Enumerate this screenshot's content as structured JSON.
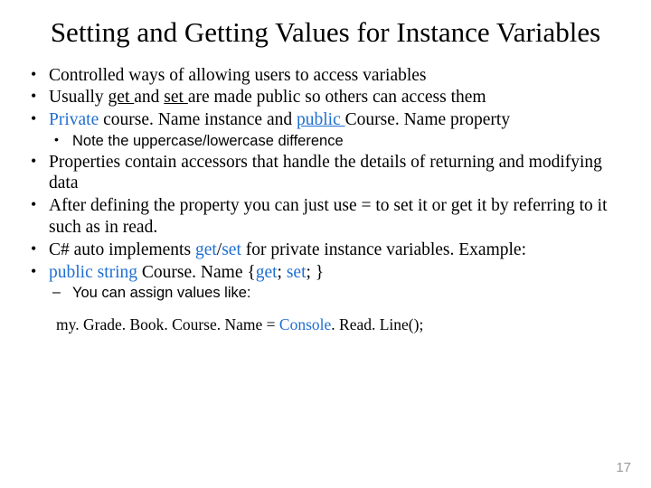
{
  "title": "Setting and Getting Values for Instance Variables",
  "b1": "Controlled ways of allowing users to access variables",
  "b2a": "Usually ",
  "b2b": "get ",
  "b2c": "and ",
  "b2d": "set ",
  "b2e": "are made public so others can access them",
  "b3a": "Private ",
  "b3b": "course. Name instance and ",
  "b3c": "public ",
  "b3d": "Course. Name property",
  "b3s": "Note the uppercase/lowercase difference",
  "b4": "Properties contain accessors that handle the details of returning and modifying data",
  "b5": "After defining the property you can just use = to set it or get it by referring to it such as in read.",
  "b6a": "C# auto implements ",
  "b6b": "get",
  "b6c": "/",
  "b6d": "set ",
  "b6e": "for private instance variables. Example:",
  "b7a": "public string ",
  "b7b": "Course. Name {",
  "b7c": "get",
  "b7d": "; ",
  "b7e": "set",
  "b7f": "; }",
  "b7s": "You can assign values like:",
  "code_a": "my. Grade. Book. Course. Name = ",
  "code_b": "Console",
  "code_c": ". Read. Line();",
  "pagenum": "17"
}
